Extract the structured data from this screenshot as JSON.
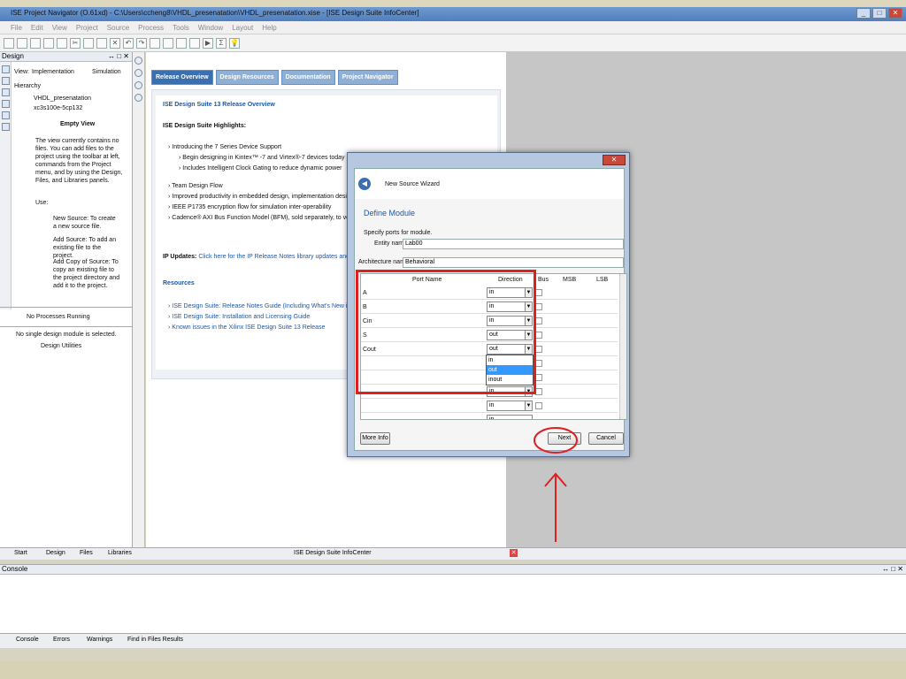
{
  "window": {
    "title": "ISE Project Navigator (O.61xd) - C:\\Users\\ccheng8\\VHDL_presenatation\\VHDL_presenatation.xise - [ISE Design Suite InfoCenter]"
  },
  "menu": [
    "File",
    "Edit",
    "View",
    "Project",
    "Source",
    "Process",
    "Tools",
    "Window",
    "Layout",
    "Help"
  ],
  "design_panel": {
    "title": "Design",
    "view_label": "View:",
    "impl": "Implementation",
    "sim": "Simulation",
    "hierarchy": "Hierarchy",
    "project": "VHDL_presenatation",
    "device": "xc3s100e-5cp132",
    "empty_title": "Empty View",
    "empty_text": "The view currently contains no files. You can add files to the project using the toolbar at left, commands from the Project menu, and by using the Design, Files, and Libraries panels.",
    "use": "Use:",
    "bullets": [
      "New Source: To create a new source file.",
      "Add Source: To add an existing file to the project.",
      "Add Copy of Source: To copy an existing file to the project directory and add it to the project."
    ],
    "no_processes": "No Processes Running",
    "no_module": "No single design module is selected.",
    "design_utilities": "Design Utilities"
  },
  "infocenter": {
    "tabs": [
      "Release Overview",
      "Design Resources",
      "Documentation",
      "Project Navigator"
    ],
    "heading": "ISE Design Suite 13 Release Overview",
    "highlights": "ISE Design Suite Highlights:",
    "items": [
      "Introducing the 7 Series Device Support",
      "Begin designing in Kintex™ -7 and Virtex®-7 devices today",
      "Includes Intelligent Clock Gating to reduce dynamic power",
      "Team Design Flow",
      "Improved productivity in embedded design, implementation design fl",
      "IEEE P1735 encryption flow for simulation inter-operability",
      "Cadence® AXI Bus Function Model (BFM), sold separately, to verify y"
    ],
    "ip_label": "IP Updates:",
    "ip_text": "Click here for the IP Release Notes library updates and new",
    "resources": "Resources",
    "links": [
      "ISE Design Suite: Release Notes Guide (Including What's New in XI",
      "ISE Design Suite: Installation and Licensing Guide",
      "Known issues in the Xilinx ISE Design Suite 13 Release"
    ]
  },
  "bottom_tabs": [
    "Start",
    "Design",
    "Files",
    "Libraries"
  ],
  "infocenter_tab": "ISE Design Suite InfoCenter",
  "console": {
    "title": "Console",
    "tabs": [
      "Console",
      "Errors",
      "Warnings",
      "Find in Files Results"
    ]
  },
  "wizard": {
    "title": "New Source Wizard",
    "section": "Define Module",
    "specify": "Specify ports for module.",
    "entity_label": "Entity name",
    "entity_value": "Lab00",
    "arch_label": "Architecture name",
    "arch_value": "Behavioral",
    "columns": [
      "Port Name",
      "Direction",
      "Bus",
      "MSB",
      "LSB"
    ],
    "ports": [
      {
        "name": "A",
        "dir": "in"
      },
      {
        "name": "B",
        "dir": "in"
      },
      {
        "name": "Cin",
        "dir": "in"
      },
      {
        "name": "S",
        "dir": "out"
      },
      {
        "name": "Cout",
        "dir": "out"
      }
    ],
    "dropdown_options": [
      "in",
      "out",
      "inout"
    ],
    "dropdown_selected": "out",
    "extra_rows": [
      "in",
      "in",
      "in"
    ],
    "more_info": "More Info",
    "next": "Next",
    "cancel": "Cancel"
  },
  "colors": {
    "annotation": "#e02020",
    "tab_active": "#3a6fb0",
    "link": "#1a58a8"
  }
}
